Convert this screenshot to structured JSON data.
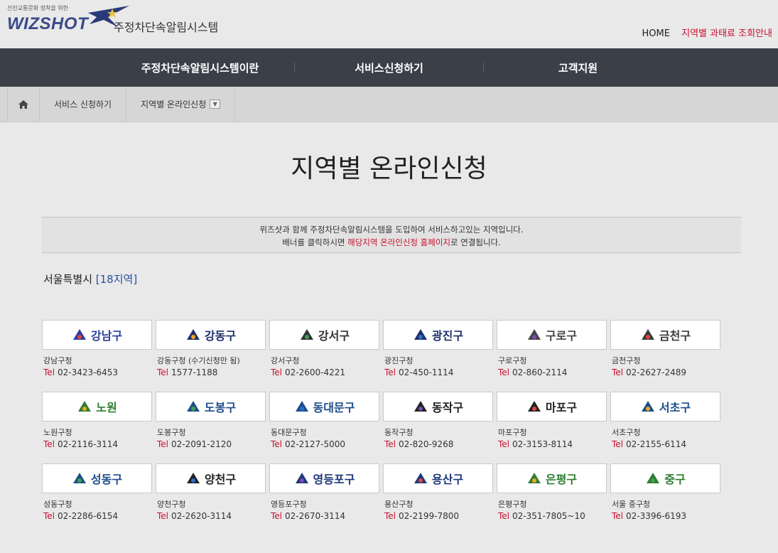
{
  "header": {
    "logo_tag": "선진교통문화 정착을 위한",
    "logo_word": "WIZSHOT",
    "logo_sub": "주정차단속알림시스템",
    "home_link": "HOME",
    "guide_link": "지역별 과태료 조회안내"
  },
  "nav": {
    "items": [
      "주정차단속알림시스템이란",
      "서비스신청하기",
      "고객지원"
    ]
  },
  "breadcrumb": {
    "level1": "서비스 신청하기",
    "level2": "지역별 온라인신청"
  },
  "page": {
    "title": "지역별 온라인신청",
    "info_line1": "위즈샷과 함께 주정차단속알림시스템을 도입하여 서비스하고있는 지역입니다.",
    "info_line2_pre": "배너를 클릭하시면 ",
    "info_line2_hl": "해당지역 온라인신청 홈페이지",
    "info_line2_post": "로 연결됩니다.",
    "region_name": "서울특별시 ",
    "region_count": "[18지역]"
  },
  "tel_label": "Tel",
  "districts": [
    {
      "banner": "강남구",
      "office": "강남구청",
      "tel": "02-3423-6453",
      "color": "#2b3f9e",
      "emblem": "gangnam-emblem-icon"
    },
    {
      "banner": "강동구",
      "office": "강동구청 (수기신청만 됨)",
      "tel": "1577-1188",
      "color": "#1e2f6b",
      "emblem": "gangdong-emblem-icon"
    },
    {
      "banner": "강서구",
      "office": "강서구청",
      "tel": "02-2600-4221",
      "color": "#333333",
      "emblem": "gangseo-emblem-icon"
    },
    {
      "banner": "광진구",
      "office": "광진구청",
      "tel": "02-450-1114",
      "color": "#1e2f6b",
      "emblem": "gwangjin-emblem-icon"
    },
    {
      "banner": "구로구",
      "office": "구로구청",
      "tel": "02-860-2114",
      "color": "#444444",
      "emblem": "guro-emblem-icon"
    },
    {
      "banner": "금천구",
      "office": "금천구청",
      "tel": "02-2627-2489",
      "color": "#3a3a3a",
      "emblem": "geumcheon-emblem-icon"
    },
    {
      "banner": "노원",
      "office": "노원구청",
      "tel": "02-2116-3114",
      "color": "#2e7d32",
      "emblem": "nowon-emblem-icon"
    },
    {
      "banner": "도봉구",
      "office": "도봉구청",
      "tel": "02-2091-2120",
      "color": "#1e4d8c",
      "emblem": "dobong-emblem-icon"
    },
    {
      "banner": "동대문구",
      "office": "동대문구청",
      "tel": "02-2127-5000",
      "color": "#1e4d8c",
      "emblem": "dongdaemun-emblem-icon"
    },
    {
      "banner": "동작구",
      "office": "동작구청",
      "tel": "02-820-9268",
      "color": "#222222",
      "emblem": "dongjak-emblem-icon"
    },
    {
      "banner": "마포구",
      "office": "마포구청",
      "tel": "02-3153-8114",
      "color": "#222222",
      "emblem": "mapo-emblem-icon"
    },
    {
      "banner": "서초구",
      "office": "서초구청",
      "tel": "02-2155-6114",
      "color": "#1e4d8c",
      "emblem": "seocho-emblem-icon"
    },
    {
      "banner": "성동구",
      "office": "성동구청",
      "tel": "02-2286-6154",
      "color": "#1e4d8c",
      "emblem": "seongdong-emblem-icon"
    },
    {
      "banner": "양천구",
      "office": "양천구청",
      "tel": "02-2620-3114",
      "color": "#222222",
      "emblem": "yangcheon-emblem-icon"
    },
    {
      "banner": "영등포구",
      "office": "영등포구청",
      "tel": "02-2670-3114",
      "color": "#1e3a7a",
      "emblem": "yeongdeungpo-emblem-icon"
    },
    {
      "banner": "용산구",
      "office": "용산구청",
      "tel": "02-2199-7800",
      "color": "#1e3a7a",
      "emblem": "yongsan-emblem-icon"
    },
    {
      "banner": "은평구",
      "office": "은평구청",
      "tel": "02-351-7805~10",
      "color": "#2e7d32",
      "emblem": "eunpyeong-emblem-icon"
    },
    {
      "banner": "중구",
      "office": "서울 중구청",
      "tel": "02-3396-6193",
      "color": "#2e7d32",
      "emblem": "junggu-emblem-icon"
    }
  ],
  "colors": {
    "nav_bg": "#3b4048",
    "accent_red": "#c8102e",
    "count_blue": "#2b4fa3",
    "page_bg": "#e9e9e9"
  }
}
